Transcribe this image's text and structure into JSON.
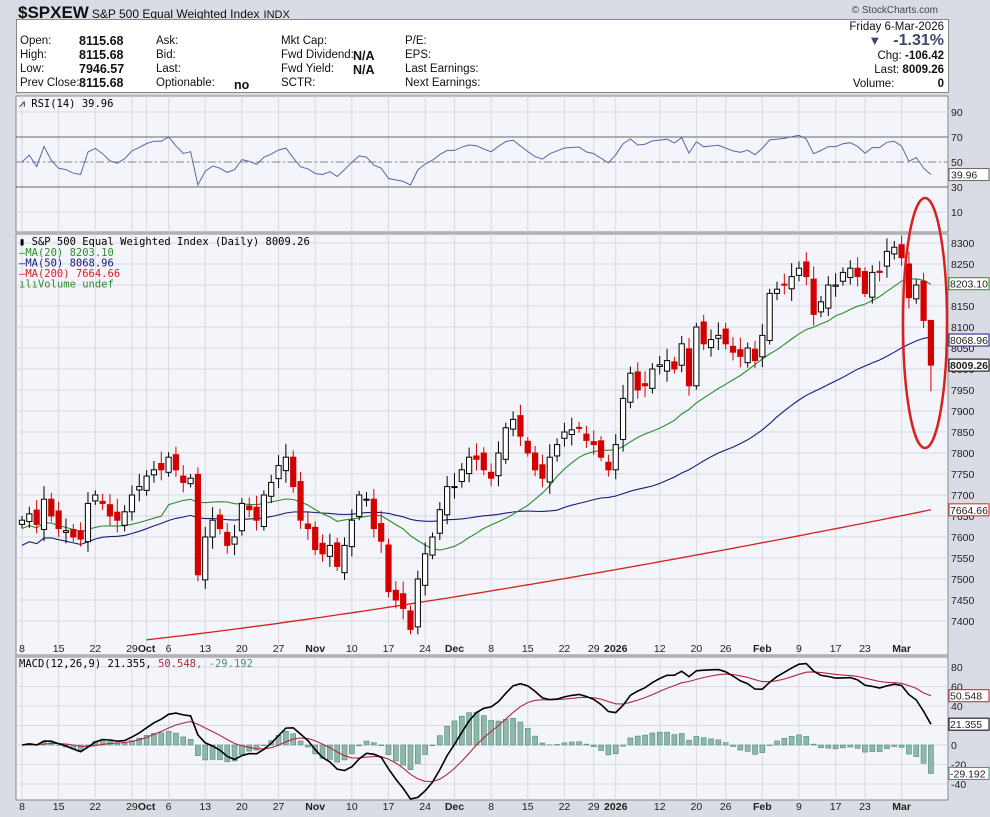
{
  "header": {
    "symbol": "$SPXEW",
    "name": "S&P 500 Equal Weighted Index",
    "exchange": "INDX",
    "copyright": "© StockCharts.com"
  },
  "quote": {
    "labels_col1": [
      "Open:",
      "High:",
      "Low:",
      "Prev Close:"
    ],
    "values_col1": [
      "8115.68",
      "8115.68",
      "7946.57",
      "8115.68"
    ],
    "labels_col2": [
      "Ask:",
      "Bid:",
      "Last:",
      "Optionable:"
    ],
    "optionable": "no",
    "labels_col3": [
      "Mkt Cap:",
      "Fwd Dividend:",
      "Fwd Yield:",
      "SCTR:"
    ],
    "fwd_dividend": "N/A",
    "fwd_yield": "N/A",
    "labels_col4": [
      "P/E:",
      "EPS:",
      "Last Earnings:",
      "Next Earnings:"
    ],
    "date": "Friday  6-Mar-2026",
    "change_pct": "-1.31%",
    "chg_label": "Chg:",
    "chg": "-106.42",
    "last_label": "Last:",
    "last": "8009.26",
    "volume_label": "Volume:",
    "volume": "0"
  },
  "colors": {
    "up": "#000000",
    "down": "#d40000",
    "ma20": "#2e8b2e",
    "ma50": "#1a1a7a",
    "ma200": "#d42020",
    "rsi": "#5a66a8",
    "macd": "#000000",
    "signal": "#b0283c",
    "hist": "#4f8c7c",
    "annotation": "#d82020"
  },
  "chart_data": [
    {
      "type": "candlestick",
      "title": "S&P 500 Equal Weighted Index (Daily) 8009.26",
      "legend": [
        "MA(20) 8203.10",
        "MA(50) 8068.96",
        "MA(200) 7664.66",
        "Volume undef"
      ],
      "ylim": [
        7350,
        8330
      ],
      "yticks": [
        7400,
        7450,
        7500,
        7550,
        7600,
        7650,
        7700,
        7750,
        7800,
        7850,
        7900,
        7950,
        8000,
        8050,
        8100,
        8150,
        8200,
        8250,
        8300
      ],
      "price_tags": [
        {
          "label": "8203.10",
          "value": 8203.1,
          "series": "ma20"
        },
        {
          "label": "8068.96",
          "value": 8068.96,
          "series": "ma50"
        },
        {
          "label": "8009.26",
          "value": 8009.26,
          "series": "last"
        },
        {
          "label": "7664.66",
          "value": 7664.66,
          "series": "ma200"
        }
      ],
      "xticks": [
        {
          "i": 0,
          "label": "8"
        },
        {
          "i": 5,
          "label": "15"
        },
        {
          "i": 10,
          "label": "22"
        },
        {
          "i": 15,
          "label": "29"
        },
        {
          "i": 17,
          "label": "Oct"
        },
        {
          "i": 20,
          "label": "6"
        },
        {
          "i": 25,
          "label": "13"
        },
        {
          "i": 30,
          "label": "20"
        },
        {
          "i": 35,
          "label": "27"
        },
        {
          "i": 40,
          "label": "Nov"
        },
        {
          "i": 45,
          "label": "10"
        },
        {
          "i": 50,
          "label": "17"
        },
        {
          "i": 55,
          "label": "24"
        },
        {
          "i": 59,
          "label": "Dec"
        },
        {
          "i": 64,
          "label": "8"
        },
        {
          "i": 69,
          "label": "15"
        },
        {
          "i": 74,
          "label": "22"
        },
        {
          "i": 78,
          "label": "29"
        },
        {
          "i": 81,
          "label": "2026"
        },
        {
          "i": 87,
          "label": "12"
        },
        {
          "i": 92,
          "label": "20"
        },
        {
          "i": 96,
          "label": "26"
        },
        {
          "i": 101,
          "label": "Feb"
        },
        {
          "i": 106,
          "label": "9"
        },
        {
          "i": 111,
          "label": "17"
        },
        {
          "i": 115,
          "label": "23"
        },
        {
          "i": 120,
          "label": "Mar"
        }
      ],
      "closes": [
        7640,
        7655,
        7630,
        7690,
        7650,
        7620,
        7615,
        7600,
        7595,
        7680,
        7700,
        7680,
        7650,
        7640,
        7660,
        7700,
        7720,
        7745,
        7760,
        7760,
        7790,
        7760,
        7730,
        7740,
        7510,
        7600,
        7640,
        7620,
        7580,
        7600,
        7680,
        7665,
        7640,
        7700,
        7730,
        7770,
        7790,
        7720,
        7640,
        7620,
        7570,
        7560,
        7580,
        7530,
        7580,
        7640,
        7700,
        7690,
        7620,
        7590,
        7470,
        7450,
        7430,
        7380,
        7500,
        7560,
        7600,
        7665,
        7720,
        7720,
        7760,
        7790,
        7785,
        7760,
        7740,
        7800,
        7860,
        7880,
        7840,
        7800,
        7760,
        7740,
        7790,
        7820,
        7850,
        7855,
        7860,
        7830,
        7820,
        7790,
        7760,
        7820,
        7930,
        7990,
        7950,
        7960,
        8000,
        8010,
        8020,
        8000,
        8060,
        7960,
        8100,
        8060,
        8070,
        8080,
        8060,
        8040,
        8030,
        8050,
        8020,
        8080,
        8180,
        8190,
        8200,
        8220,
        8240,
        8220,
        8130,
        8160,
        8200,
        8200,
        8230,
        8240,
        8220,
        8180,
        8230,
        8230,
        8280,
        8290,
        8265,
        8170,
        8200,
        8115.68,
        8009.26
      ],
      "last_candle": {
        "open": 8115.68,
        "high": 8115.68,
        "low": 7946.57,
        "close": 8009.26
      },
      "ma200_range": [
        7330,
        7664.66
      ],
      "annotation": "red ellipse around last 6 sessions"
    },
    {
      "type": "line",
      "title": "RSI(14) 39.96",
      "ylim": [
        0,
        100
      ],
      "yticks": [
        90,
        70,
        50,
        30,
        10
      ],
      "last_label": "39.96"
    },
    {
      "type": "line",
      "title_parts": [
        "MACD(12,26,9) 21.355, ",
        "50.548",
        ", -29.192"
      ],
      "ylim": [
        -50,
        90
      ],
      "yticks": [
        80,
        60,
        40,
        20,
        0,
        -20,
        -40
      ],
      "tags": [
        {
          "label": "50.548",
          "value": 50.548
        },
        {
          "label": "21.355",
          "value": 21.355
        },
        {
          "label": "-29.192",
          "value": -29.192
        }
      ]
    }
  ]
}
